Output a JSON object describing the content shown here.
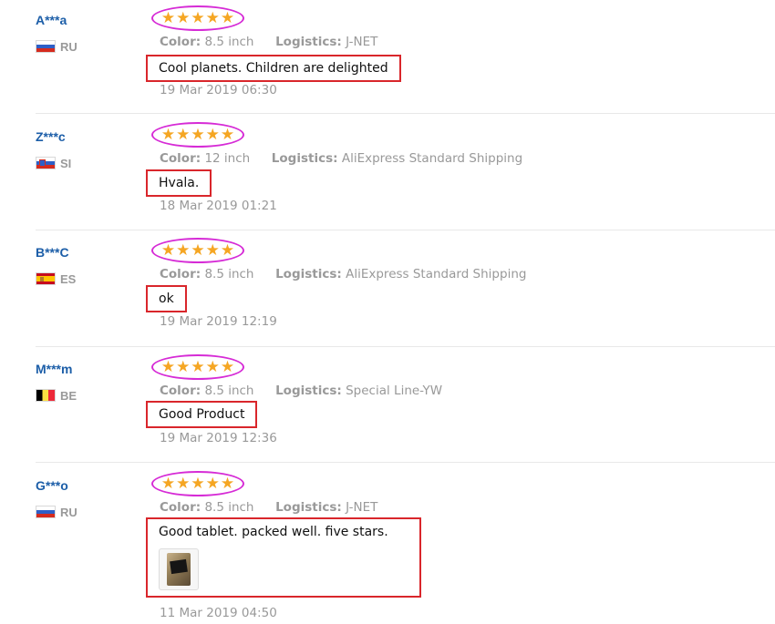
{
  "labels": {
    "color": "Color:",
    "logistics": "Logistics:"
  },
  "star_glyph": "★",
  "colors": {
    "username": "#1c5ea8",
    "star": "#f5a623",
    "ring": "#d62bd6",
    "box": "#d9262b",
    "muted": "#999999"
  },
  "reviews": [
    {
      "user": "A***a",
      "country": "RU",
      "flag": "flag-ru",
      "rating": 5,
      "color_value": "8.5 inch",
      "logistics_value": "J-NET",
      "comment": "Cool planets. Children are delighted",
      "date": "19 Mar 2019 06:30",
      "has_photo": false
    },
    {
      "user": "Z***c",
      "country": "SI",
      "flag": "flag-si",
      "rating": 5,
      "color_value": "12 inch",
      "logistics_value": "AliExpress Standard Shipping",
      "comment": "Hvala.",
      "date": "18 Mar 2019 01:21",
      "has_photo": false
    },
    {
      "user": "B***C",
      "country": "ES",
      "flag": "flag-es",
      "rating": 5,
      "color_value": "8.5 inch",
      "logistics_value": "AliExpress Standard Shipping",
      "comment": "ok",
      "date": "19 Mar 2019 12:19",
      "has_photo": false
    },
    {
      "user": "M***m",
      "country": "BE",
      "flag": "flag-be",
      "rating": 5,
      "color_value": "8.5 inch",
      "logistics_value": "Special Line-YW",
      "comment": "Good Product",
      "date": "19 Mar 2019 12:36",
      "has_photo": false
    },
    {
      "user": "G***o",
      "country": "RU",
      "flag": "flag-ru",
      "rating": 5,
      "color_value": "8.5 inch",
      "logistics_value": "J-NET",
      "comment": "Good tablet. packed well. five stars.",
      "date": "11 Mar 2019 04:50",
      "has_photo": true
    }
  ]
}
